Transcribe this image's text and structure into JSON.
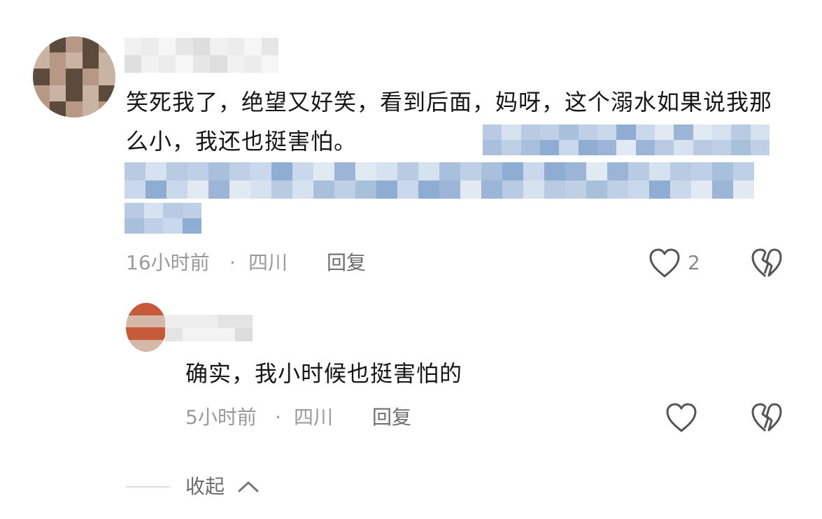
{
  "comment": {
    "text": "笑死我了，绝望又好笑，看到后面，妈呀，这个溺水如果说我那么小，我还也挺害怕。",
    "time": "16小时前",
    "separator": "·",
    "location": "四川",
    "reply_label": "回复",
    "like_count": "2"
  },
  "reply": {
    "text": "确实，我小时候也挺害怕的",
    "time": "5小时前",
    "separator": "·",
    "location": "四川",
    "reply_label": "回复"
  },
  "collapse": {
    "label": "收起"
  },
  "icons": {
    "like": "heart-outline-icon",
    "dislike": "broken-heart-icon",
    "collapse": "chevron-up-icon"
  },
  "colors": {
    "text": "#161616",
    "meta": "#9a9a9a",
    "icon": "#555555"
  }
}
